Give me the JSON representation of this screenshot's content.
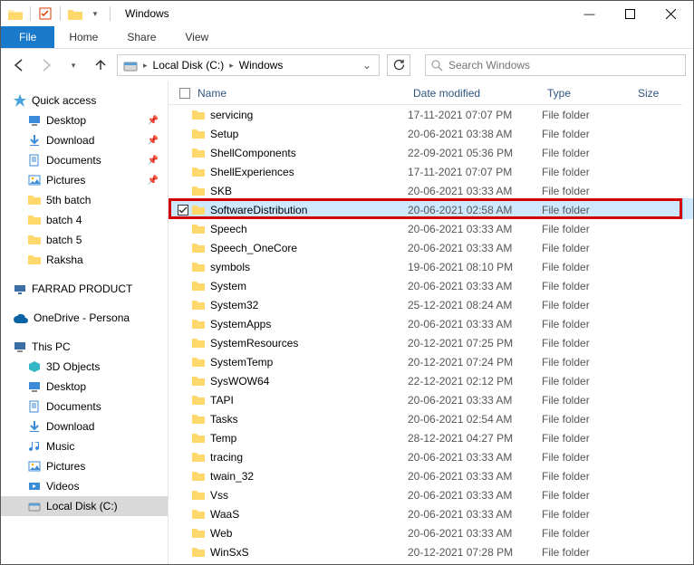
{
  "window": {
    "title": "Windows",
    "min": "—",
    "max": "▢",
    "close": "✕"
  },
  "ribbon": {
    "file": "File",
    "tabs": [
      "Home",
      "Share",
      "View"
    ]
  },
  "nav": {
    "back": "←",
    "forward": "→",
    "recent": "▾",
    "up": "↑",
    "refresh": "⟳"
  },
  "breadcrumb": {
    "root_icon": "disk-icon",
    "parts": [
      "Local Disk (C:)",
      "Windows"
    ]
  },
  "search": {
    "placeholder": "Search Windows",
    "icon": "🔍"
  },
  "columns": {
    "name": "Name",
    "date": "Date modified",
    "type": "Type",
    "size": "Size"
  },
  "navpane": {
    "quick": {
      "label": "Quick access",
      "items": [
        {
          "label": "Desktop",
          "icon": "desktop",
          "pinned": true
        },
        {
          "label": "Download",
          "icon": "download",
          "pinned": true
        },
        {
          "label": "Documents",
          "icon": "documents",
          "pinned": true
        },
        {
          "label": "Pictures",
          "icon": "pictures",
          "pinned": true
        },
        {
          "label": "5th batch",
          "icon": "folder",
          "pinned": false
        },
        {
          "label": "batch 4",
          "icon": "folder",
          "pinned": false
        },
        {
          "label": "batch 5",
          "icon": "folder",
          "pinned": false
        },
        {
          "label": "Raksha",
          "icon": "folder",
          "pinned": false
        }
      ]
    },
    "farrad": "FARRAD PRODUCT",
    "onedrive": "OneDrive - Persona",
    "thispc": {
      "label": "This PC",
      "items": [
        {
          "label": "3D Objects",
          "icon": "3d"
        },
        {
          "label": "Desktop",
          "icon": "desktop"
        },
        {
          "label": "Documents",
          "icon": "documents"
        },
        {
          "label": "Download",
          "icon": "download"
        },
        {
          "label": "Music",
          "icon": "music"
        },
        {
          "label": "Pictures",
          "icon": "pictures"
        },
        {
          "label": "Videos",
          "icon": "videos"
        },
        {
          "label": "Local Disk (C:)",
          "icon": "disk",
          "selected": true
        }
      ]
    }
  },
  "files": [
    {
      "name": "servicing",
      "date": "17-11-2021 07:07 PM",
      "type": "File folder"
    },
    {
      "name": "Setup",
      "date": "20-06-2021 03:38 AM",
      "type": "File folder"
    },
    {
      "name": "ShellComponents",
      "date": "22-09-2021 05:36 PM",
      "type": "File folder"
    },
    {
      "name": "ShellExperiences",
      "date": "17-11-2021 07:07 PM",
      "type": "File folder"
    },
    {
      "name": "SKB",
      "date": "20-06-2021 03:33 AM",
      "type": "File folder"
    },
    {
      "name": "SoftwareDistribution",
      "date": "20-06-2021 02:58 AM",
      "type": "File folder",
      "selected": true,
      "checked": true,
      "highlighted": true
    },
    {
      "name": "Speech",
      "date": "20-06-2021 03:33 AM",
      "type": "File folder"
    },
    {
      "name": "Speech_OneCore",
      "date": "20-06-2021 03:33 AM",
      "type": "File folder"
    },
    {
      "name": "symbols",
      "date": "19-06-2021 08:10 PM",
      "type": "File folder"
    },
    {
      "name": "System",
      "date": "20-06-2021 03:33 AM",
      "type": "File folder"
    },
    {
      "name": "System32",
      "date": "25-12-2021 08:24 AM",
      "type": "File folder"
    },
    {
      "name": "SystemApps",
      "date": "20-06-2021 03:33 AM",
      "type": "File folder"
    },
    {
      "name": "SystemResources",
      "date": "20-12-2021 07:25 PM",
      "type": "File folder"
    },
    {
      "name": "SystemTemp",
      "date": "20-12-2021 07:24 PM",
      "type": "File folder"
    },
    {
      "name": "SysWOW64",
      "date": "22-12-2021 02:12 PM",
      "type": "File folder"
    },
    {
      "name": "TAPI",
      "date": "20-06-2021 03:33 AM",
      "type": "File folder"
    },
    {
      "name": "Tasks",
      "date": "20-06-2021 02:54 AM",
      "type": "File folder"
    },
    {
      "name": "Temp",
      "date": "28-12-2021 04:27 PM",
      "type": "File folder"
    },
    {
      "name": "tracing",
      "date": "20-06-2021 03:33 AM",
      "type": "File folder"
    },
    {
      "name": "twain_32",
      "date": "20-06-2021 03:33 AM",
      "type": "File folder"
    },
    {
      "name": "Vss",
      "date": "20-06-2021 03:33 AM",
      "type": "File folder"
    },
    {
      "name": "WaaS",
      "date": "20-06-2021 03:33 AM",
      "type": "File folder"
    },
    {
      "name": "Web",
      "date": "20-06-2021 03:33 AM",
      "type": "File folder"
    },
    {
      "name": "WinSxS",
      "date": "20-12-2021 07:28 PM",
      "type": "File folder"
    }
  ]
}
